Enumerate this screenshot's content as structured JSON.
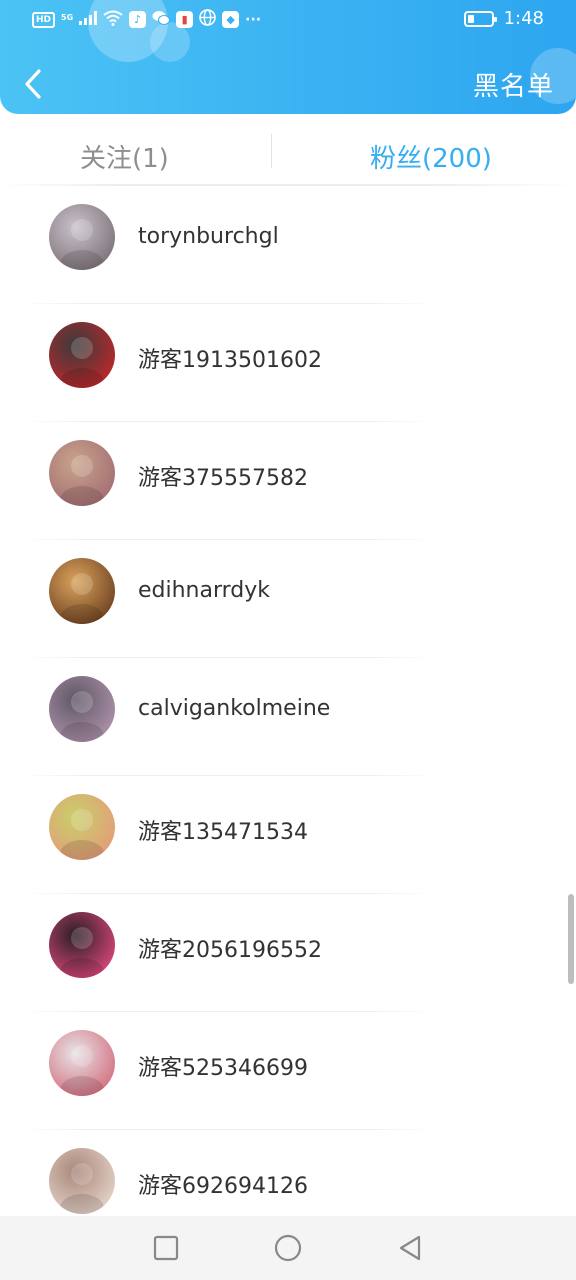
{
  "status_bar": {
    "left_indicators": [
      "HD",
      "5G",
      "signal-icon",
      "wifi-icon",
      "music-app-icon",
      "wechat-icon",
      "red-app-icon",
      "globe-icon",
      "blue-app-icon",
      "more-icon"
    ],
    "signal_label": "5G",
    "hd_label": "HD",
    "more_label": "···",
    "battery_level": 0.3,
    "time": "1:48"
  },
  "header": {
    "back_icon": "chevron-left-icon",
    "blacklist_label": "黑名单",
    "background_color": "#3ab2f2"
  },
  "tabs": [
    {
      "label": "关注(1)",
      "active": false
    },
    {
      "label": "粉丝(200)",
      "active": true
    }
  ],
  "active_tab_color": "#36aef0",
  "fans": [
    {
      "name": "torynburchgl",
      "avatar_colors": [
        "#c9c2cb",
        "#7a6e75"
      ]
    },
    {
      "name": "游客1913501602",
      "avatar_colors": [
        "#3b3b3b",
        "#c3262b"
      ]
    },
    {
      "name": "游客375557582",
      "avatar_colors": [
        "#c8a48a",
        "#a26b73"
      ]
    },
    {
      "name": "edihnarrdyk",
      "avatar_colors": [
        "#d9a25b",
        "#6a3e1f"
      ]
    },
    {
      "name": "calvigankolmeine",
      "avatar_colors": [
        "#5f5866",
        "#b294ad"
      ]
    },
    {
      "name": "游客135471534",
      "avatar_colors": [
        "#c8cf6a",
        "#e59a7a"
      ]
    },
    {
      "name": "游客2056196552",
      "avatar_colors": [
        "#2a1f25",
        "#e0487f"
      ]
    },
    {
      "name": "游客525346699",
      "avatar_colors": [
        "#e6e3e6",
        "#d36a7b"
      ]
    },
    {
      "name": "游客692694126",
      "avatar_colors": [
        "#a9877a",
        "#e8d6cc"
      ]
    }
  ],
  "nav_bar": {
    "buttons": [
      "recent-apps-square-icon",
      "home-circle-icon",
      "back-triangle-icon"
    ]
  }
}
